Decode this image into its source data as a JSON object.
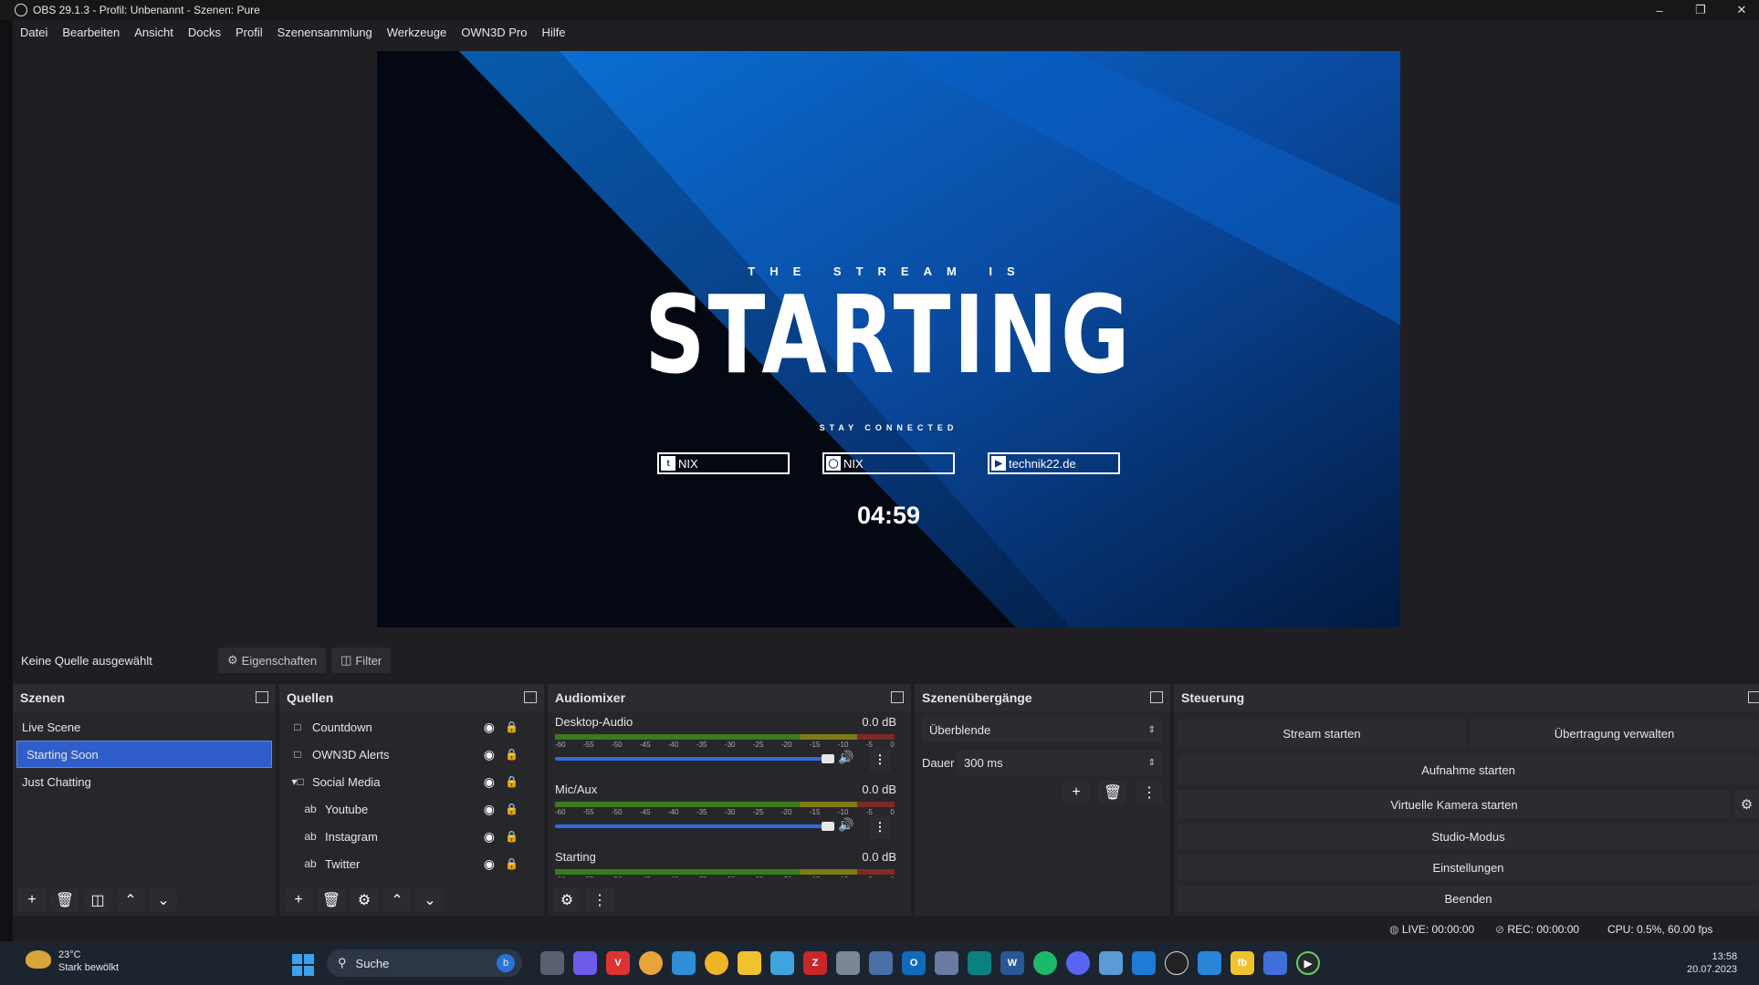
{
  "titlebar": {
    "title": "OBS 29.1.3 - Profil: Unbenannt - Szenen: Pure"
  },
  "menu": [
    "Datei",
    "Bearbeiten",
    "Ansicht",
    "Docks",
    "Profil",
    "Szenensammlung",
    "Werkzeuge",
    "OWN3D Pro",
    "Hilfe"
  ],
  "preview": {
    "pre_title": "THE STREAM IS",
    "title": "STARTING",
    "subtitle": "STAY CONNECTED",
    "socials": [
      {
        "icon": "twitter-icon",
        "label": "NIX"
      },
      {
        "icon": "instagram-icon",
        "label": "NIX"
      },
      {
        "icon": "youtube-icon",
        "label": "technik22.de"
      }
    ],
    "countdown": "04:59",
    "colors": {
      "accent": "#0d5fc4",
      "dark": "#050a14"
    }
  },
  "source_bar": {
    "no_source": "Keine Quelle ausgewählt",
    "properties": "Eigenschaften",
    "filter": "Filter"
  },
  "scenes": {
    "title": "Szenen",
    "items": [
      "Live Scene",
      "Starting Soon",
      "Just Chatting"
    ],
    "selected": "Starting Soon"
  },
  "sources": {
    "title": "Quellen",
    "items": [
      {
        "label": "Countdown",
        "type": "file"
      },
      {
        "label": "OWN3D Alerts",
        "type": "file"
      },
      {
        "label": "Social Media",
        "type": "folder"
      },
      {
        "label": "Youtube",
        "type": "text"
      },
      {
        "label": "Instagram",
        "type": "text"
      },
      {
        "label": "Twitter",
        "type": "text"
      }
    ]
  },
  "mixer": {
    "title": "Audiomixer",
    "ticks": [
      "-60",
      "-55",
      "-50",
      "-45",
      "-40",
      "-35",
      "-30",
      "-25",
      "-20",
      "-15",
      "-10",
      "-5",
      "0"
    ],
    "channels": [
      {
        "name": "Desktop-Audio",
        "db": "0.0 dB",
        "volume": 1.0
      },
      {
        "name": "Mic/Aux",
        "db": "0.0 dB",
        "volume": 1.0
      },
      {
        "name": "Starting",
        "db": "0.0 dB",
        "volume": 1.0
      }
    ]
  },
  "transitions": {
    "title": "Szenenübergänge",
    "selected": "Überblende",
    "duration_label": "Dauer",
    "duration": "300 ms"
  },
  "controls": {
    "title": "Steuerung",
    "stream": "Stream starten",
    "manage": "Übertragung verwalten",
    "record": "Aufnahme starten",
    "virtualcam": "Virtuelle Kamera starten",
    "studio": "Studio-Modus",
    "settings": "Einstellungen",
    "exit": "Beenden"
  },
  "status": {
    "live": "LIVE: 00:00:00",
    "rec": "REC: 00:00:00",
    "cpu": "CPU: 0.5%, 60.00 fps"
  },
  "taskbar": {
    "weather_temp": "23°C",
    "weather_desc": "Stark bewölkt",
    "search": "Suche",
    "time": "13:58",
    "date": "20.07.2023"
  }
}
